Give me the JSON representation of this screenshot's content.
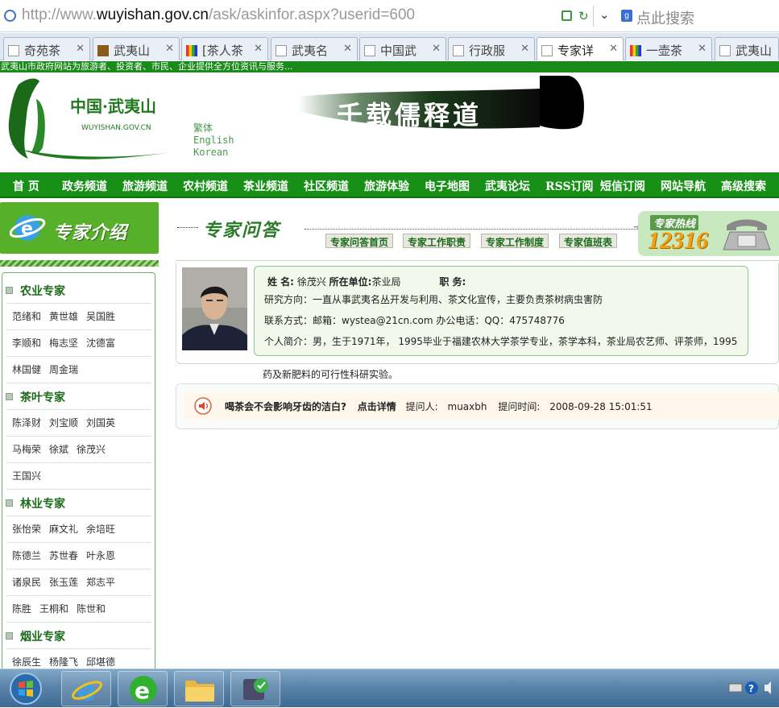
{
  "browser": {
    "url_prefix": "http://www.",
    "url_domain": "wuyishan.gov.cn",
    "url_path": "/ask/askinfor.aspx?userid=600",
    "search_placeholder": "点此搜索",
    "tabs": [
      {
        "label": "奇苑茶",
        "icon": "page-icon"
      },
      {
        "label": "武夷山",
        "icon": "paw-icon"
      },
      {
        "label": "[茶人茶",
        "icon": "colorful-icon"
      },
      {
        "label": "武夷名",
        "icon": "page-icon"
      },
      {
        "label": "中国武",
        "icon": "page-icon"
      },
      {
        "label": "行政服",
        "icon": "page-icon"
      },
      {
        "label": "专家详",
        "icon": "page-icon",
        "active": true
      },
      {
        "label": "一壶茶",
        "icon": "colorful-icon"
      },
      {
        "label": "武夷山",
        "icon": "page-icon"
      }
    ]
  },
  "site": {
    "info_bar": "武夷山市政府网站为旅游者、投资者、市民、企业提供全方位资讯与服务...",
    "logo_text": "中国·武夷山",
    "logo_domain": "WUYISHAN.GOV.CN",
    "banner_text": "千载儒释道",
    "languages": [
      "繁体",
      "English",
      "Korean"
    ],
    "nav": [
      "首 页",
      "政务频道",
      "旅游频道",
      "农村频道",
      "茶业频道",
      "社区频道",
      "旅游体验",
      "电子地图",
      "武夷论坛",
      "RSS订阅",
      "短信订阅",
      "网站导航",
      "高级搜索"
    ]
  },
  "sidebar": {
    "title": "专家介绍",
    "categories": [
      {
        "name": "农业专家",
        "rows": [
          [
            "范绪和",
            "黄世雄",
            "吴国胜"
          ],
          [
            "李顺和",
            "梅志坚",
            "沈德富"
          ],
          [
            "林国健",
            "周金瑞"
          ]
        ]
      },
      {
        "name": "茶叶专家",
        "rows": [
          [
            "陈泽财",
            "刘宝顺",
            "刘国英"
          ],
          [
            "马梅荣",
            "徐斌",
            "徐茂兴"
          ],
          [
            "王国兴"
          ]
        ]
      },
      {
        "name": "林业专家",
        "rows": [
          [
            "张怡荣",
            "麻文礼",
            "余培旺"
          ],
          [
            "陈德兰",
            "苏世春",
            "叶永恩"
          ],
          [
            "诸泉民",
            "张玉莲",
            "郑志平"
          ],
          [
            "陈胜",
            "王桐和",
            "陈世和"
          ]
        ]
      },
      {
        "name": "烟业专家",
        "rows": [
          [
            "徐辰生",
            "杨隆飞",
            "邱堪德"
          ]
        ]
      }
    ]
  },
  "qa": {
    "title": "专家问答",
    "buttons": [
      "专家问答首页",
      "专家工作职责",
      "专家工作制度",
      "专家值班表"
    ],
    "hotline_label": "专家热线",
    "hotline_number": "12316"
  },
  "expert": {
    "name_label": "姓 名:",
    "name": "徐茂兴",
    "unit_label": "所在单位:",
    "unit": "茶业局",
    "title_label": "职 务:",
    "title": "",
    "research": "研究方向：一直从事武夷名丛开发与利用、茶文化宣传，主要负责茶树病虫害防",
    "contact": "联系方式：邮箱：wystea@21cn.com 办公电话：QQ：475748776",
    "bio": "个人简介：男，生于1971年， 1995毕业于福建农林大学茶学专业，茶学本科，茶业局农艺师、评茶师，1995",
    "bio_tail": "药及新肥料的可行性科研实验。"
  },
  "question": {
    "text": "喝茶会不会影响牙齿的洁白?",
    "link": "点击详情",
    "asker_label": "提问人:",
    "asker": "muaxbh",
    "time_label": "提问时间:",
    "time": "2008-09-28 15:01:51"
  },
  "colors": {
    "brand_green": "#189018",
    "info_bar": "#1a8a1a",
    "hotline_orange": "#f0a010"
  }
}
